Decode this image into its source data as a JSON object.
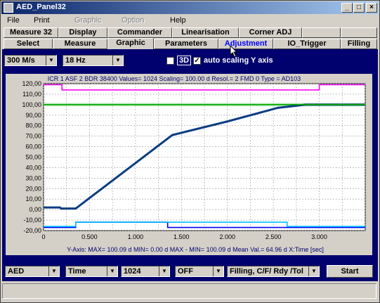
{
  "window": {
    "title": "AED_Panel32",
    "minimize": "_",
    "maximize": "□",
    "close": "×"
  },
  "menu": [
    "File",
    "Print",
    "Graphic",
    "Option",
    "Help"
  ],
  "tabs_row1": [
    "Measure 32",
    "Display",
    "Commander",
    "Linearisation",
    "Corner ADJ",
    ""
  ],
  "tabs_row2": [
    "Select",
    "Measure",
    "Graphic",
    "Parameters",
    "Adjustment",
    "IO_Trigger",
    "Filling"
  ],
  "active_tab": "Graphic",
  "hover_tab": "Adjustment",
  "controls": {
    "rate": "300 M/s",
    "freq": "18  Hz",
    "check_3d_label": "3D",
    "check_3d": false,
    "autoscale_label": "auto scaling Y axis",
    "autoscale": true
  },
  "chart_info": "ICR 1   ASF  2   BDR 38400   Values= 1024   Scaling= 100.00 d     Resol.=  2   FMD 0   Type = AD103",
  "chart_footer": "Y-Axis:  MAX= 100.09 d    MIN=   0.00 d    MAX - MIN= 100.09 d    Mean Val.= 64.96 d    X:Time [sec]",
  "bottom": {
    "sel1": "AED",
    "sel2": "Time",
    "sel3": "1024",
    "sel4": "OFF",
    "sel5": "Filling, C/F/ Rdy /Tol",
    "start": "Start"
  },
  "colors": {
    "panel": "#00006e",
    "main_series": "#0a3d82",
    "upper_limit": "#ff00ff",
    "target": "#00aa00",
    "lower_band": "#0000ff",
    "lower_band2": "#00c0ff"
  },
  "chart_data": {
    "type": "line",
    "xlim": [
      0,
      3.5
    ],
    "ylim": [
      -20,
      120
    ],
    "xticks": [
      "0",
      "0.500",
      "1.000",
      "1.500",
      "2.000",
      "2.500",
      "3.000"
    ],
    "yticks": [
      "120,00",
      "110,00",
      "100,00",
      "90,00",
      "80,00",
      "70,00",
      "60,00",
      "50,00",
      "40,00",
      "30,00",
      "20,00",
      "10,00",
      "0,00",
      "-10,00",
      "-20,00"
    ],
    "series": [
      {
        "color": "#0a3d82",
        "x": [
          0,
          0.18,
          0.19,
          0.35,
          1.4,
          2.0,
          2.55,
          2.85,
          3.5
        ],
        "y": [
          2,
          2,
          1,
          1,
          71,
          84,
          97,
          100,
          100
        ]
      },
      {
        "color": "#ff00ff",
        "x": [
          0,
          0.2,
          0.2,
          3.0,
          3.0,
          3.5
        ],
        "y": [
          119,
          119,
          114,
          114,
          119,
          119
        ]
      },
      {
        "color": "#00aa00",
        "x": [
          0,
          3.5
        ],
        "y": [
          100,
          100
        ]
      },
      {
        "color": "#0000ff",
        "x": [
          0,
          0.35,
          0.35,
          1.35,
          1.35,
          3.5
        ],
        "y": [
          -17,
          -17,
          -12,
          -12,
          -17,
          -17
        ]
      },
      {
        "color": "#00c0ff",
        "x": [
          0,
          0.35,
          0.35,
          2.65,
          2.65,
          3.5
        ],
        "y": [
          -16,
          -16,
          -12,
          -12,
          -16,
          -16
        ]
      }
    ]
  }
}
